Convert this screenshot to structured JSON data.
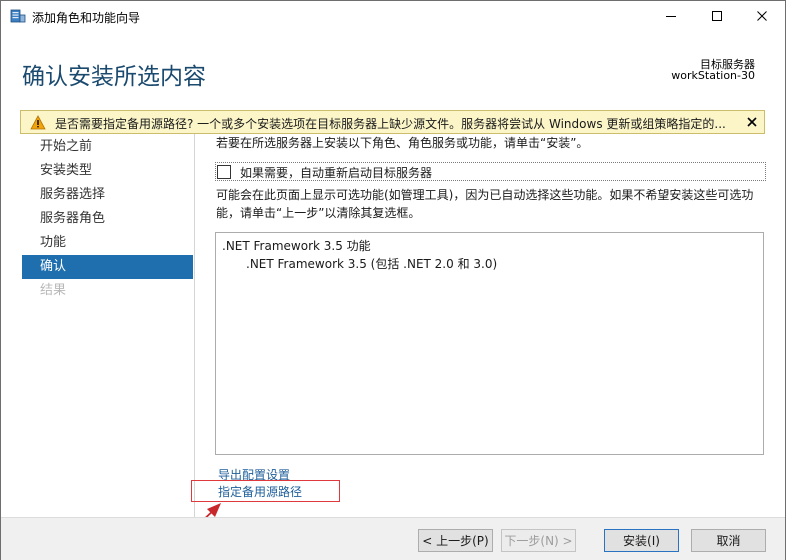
{
  "window": {
    "title": "添加角色和功能向导",
    "controls": [
      "minimize-icon",
      "maximize-icon",
      "close-icon"
    ]
  },
  "header": {
    "title": "确认安装所选内容",
    "destination_label": "目标服务器",
    "destination_value": "workStation-30"
  },
  "warning": {
    "text": "是否需要指定备用源路径? 一个或多个安装选项在目标服务器上缺少源文件。服务器将尝试从 Windows 更新或组策略指定的...",
    "icon": "warning-triangle-icon"
  },
  "sidebar": {
    "items": [
      {
        "label": "开始之前",
        "state": "normal"
      },
      {
        "label": "安装类型",
        "state": "normal"
      },
      {
        "label": "服务器选择",
        "state": "normal"
      },
      {
        "label": "服务器角色",
        "state": "normal"
      },
      {
        "label": "功能",
        "state": "normal"
      },
      {
        "label": "确认",
        "state": "active"
      },
      {
        "label": "结果",
        "state": "disabled"
      }
    ]
  },
  "main": {
    "intro": "若要在所选服务器上安装以下角色、角色服务或功能，请单击“安装”。",
    "restart_label": "如果需要，自动重新启动目标服务器",
    "restart_checked": false,
    "note": "可能会在此页面上显示可选功能(如管理工具)，因为已自动选择这些功能。如果不希望安装这些可选功能，请单击“上一步”以清除其复选框。",
    "features": [
      ".NET Framework 3.5 功能",
      ".NET Framework 3.5 (包括 .NET 2.0 和 3.0)"
    ],
    "export_link": "导出配置设置",
    "alt_source_link": "指定备用源路径"
  },
  "footer": {
    "previous": "< 上一步(P)",
    "next": "下一步(N) >",
    "install": "安装(I)",
    "cancel": "取消"
  },
  "colors": {
    "accent": "#1f6fae",
    "title": "#1b4a6f",
    "warning_bg": "#fbf5c8",
    "link": "#1f5f9a",
    "annotation": "#e0393d"
  }
}
